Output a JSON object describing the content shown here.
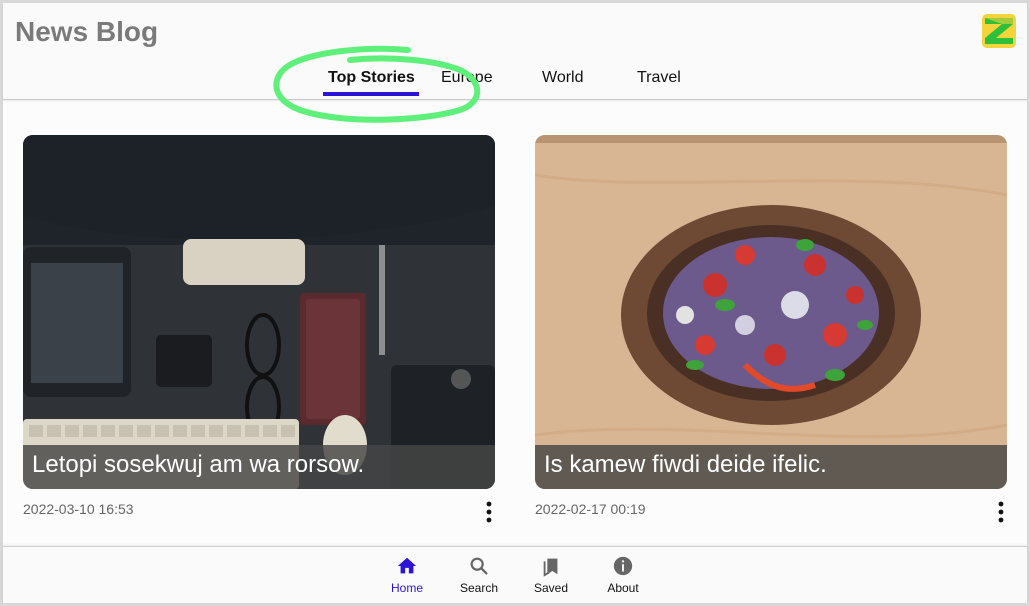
{
  "header": {
    "title": "News Blog",
    "tabs": [
      {
        "label": "Top Stories",
        "active": true
      },
      {
        "label": "Europe",
        "active": false
      },
      {
        "label": "World",
        "active": false
      },
      {
        "label": "Travel",
        "active": false
      }
    ]
  },
  "cards": [
    {
      "caption": "Letopi sosekwuj am wa rorsow.",
      "date": "2022-03-10 16:53",
      "image": "desk-workspace-photo"
    },
    {
      "caption": "Is kamew fiwdi deide ifelic.",
      "date": "2022-02-17 00:19",
      "image": "salad-bowl-photo"
    }
  ],
  "bottom_nav": [
    {
      "label": "Home",
      "icon": "home-icon",
      "active": true
    },
    {
      "label": "Search",
      "icon": "search-icon",
      "active": false
    },
    {
      "label": "Saved",
      "icon": "bookmark-icon",
      "active": false
    },
    {
      "label": "About",
      "icon": "info-icon",
      "active": false
    }
  ],
  "colors": {
    "accent": "#2b14d6",
    "annotation": "#5ef07a",
    "title": "#7a7a7a"
  }
}
